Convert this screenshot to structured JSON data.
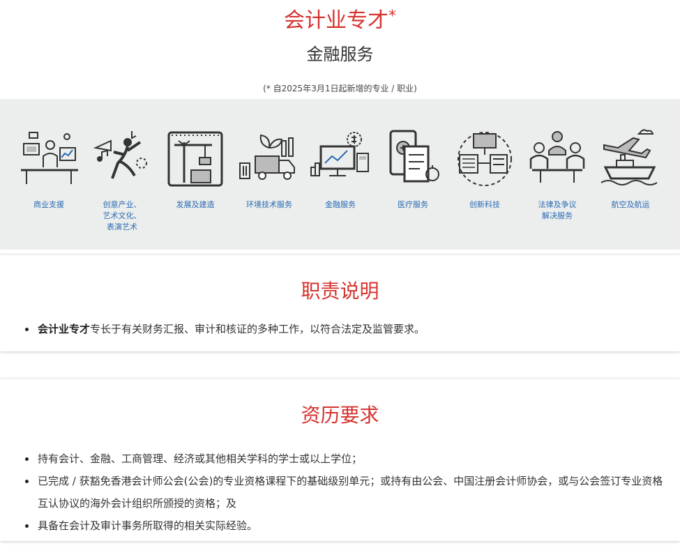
{
  "header": {
    "title": "会计业专才",
    "title_mark": "*",
    "subtitle": "金融服务",
    "note": "(* 自2025年3月1日起新增的专业 / 职业)"
  },
  "sectors": [
    {
      "label": "商业支援",
      "icon": "office-desk-icon"
    },
    {
      "label": "创意产业、\n艺术文化、\n表演艺术",
      "icon": "dancer-trumpet-icon"
    },
    {
      "label": "发展及建造",
      "icon": "crane-blueprint-icon"
    },
    {
      "label": "环境技术服务",
      "icon": "recycle-truck-icon"
    },
    {
      "label": "金融服务",
      "icon": "finance-monitor-icon"
    },
    {
      "label": "医疗服务",
      "icon": "medical-tablet-icon"
    },
    {
      "label": "创新科技",
      "icon": "tech-server-icon"
    },
    {
      "label": "法律及争议\n解决服务",
      "icon": "legal-meeting-icon"
    },
    {
      "label": "航空及航运",
      "icon": "plane-ship-icon"
    }
  ],
  "duties": {
    "heading": "职责说明",
    "items": [
      {
        "bold": "会计业专才",
        "text": "专长于有关财务汇报、审计和核证的多种工作，以符合法定及监管要求。"
      }
    ]
  },
  "requirements": {
    "heading": "资历要求",
    "items": [
      "持有会计、金融、工商管理、经济或其他相关学科的学士或以上学位；",
      "已完成 / 获豁免香港会计师公会(公会)的专业资格课程下的基础级别单元；或持有由公会、中国注册会计师协会，或与公会签订专业资格互认协议的海外会计组织所颁授的资格；及",
      "具备在会计及审计事务所取得的相关实际经验。"
    ]
  },
  "colors": {
    "accent": "#d6322e",
    "link": "#2a6bb0",
    "band": "#eceeee"
  }
}
